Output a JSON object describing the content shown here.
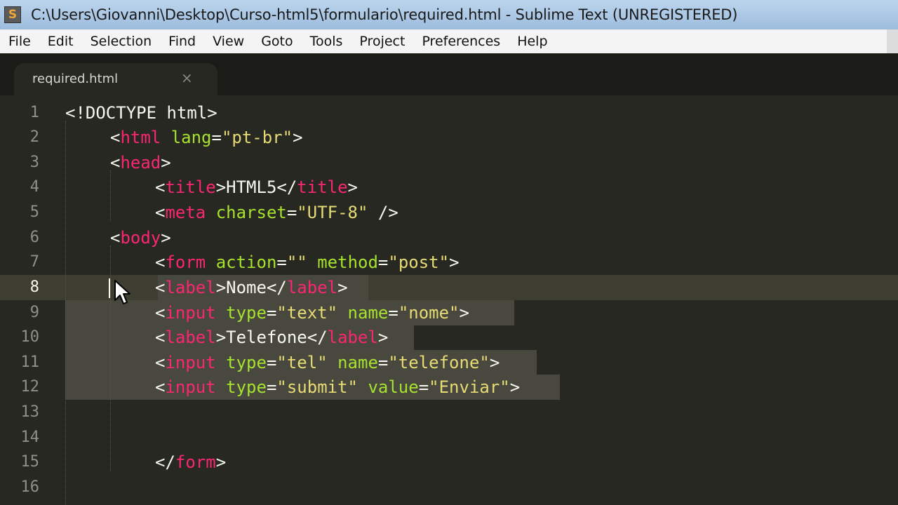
{
  "window": {
    "title": "C:\\Users\\Giovanni\\Desktop\\Curso-html5\\formulario\\required.html - Sublime Text (UNREGISTERED)",
    "icon_glyph": "S"
  },
  "menu": [
    "File",
    "Edit",
    "Selection",
    "Find",
    "View",
    "Goto",
    "Tools",
    "Project",
    "Preferences",
    "Help"
  ],
  "tab": {
    "label": "required.html",
    "close_glyph": "×"
  },
  "editor": {
    "active_line": 8,
    "line_numbers": [
      "1",
      "2",
      "3",
      "4",
      "5",
      "6",
      "7",
      "8",
      "9",
      "10",
      "11",
      "12",
      "13",
      "14",
      "15",
      "16"
    ],
    "lines": {
      "l1": {
        "t0": "<!DOCTYPE html>"
      },
      "l2": {
        "t0": "<",
        "t1": "html",
        "t2": " lang",
        "t3": "=",
        "t4": "\"pt-br\"",
        "t5": ">"
      },
      "l3": {
        "t0": "<",
        "t1": "head",
        "t2": ">"
      },
      "l4": {
        "t0": "<",
        "t1": "title",
        "t2": ">HTML5</",
        "t3": "title",
        "t4": ">"
      },
      "l5": {
        "t0": "<",
        "t1": "meta",
        "t2": " charset",
        "t3": "=",
        "t4": "\"UTF-8\"",
        "t5": " />"
      },
      "l6": {
        "t0": "<",
        "t1": "body",
        "t2": ">"
      },
      "l7": {
        "t0": "<",
        "t1": "form",
        "t2": " action",
        "t3": "=",
        "t4": "\"\"",
        "t5": " method",
        "t6": "=",
        "t7": "\"post\"",
        "t8": ">"
      },
      "l8": {
        "t0": "<",
        "t1": "label",
        "t2": ">Nome</",
        "t3": "label",
        "t4": ">"
      },
      "l9": {
        "t0": "<",
        "t1": "input",
        "t2": " type",
        "t3": "=",
        "t4": "\"text\"",
        "t5": " name",
        "t6": "=",
        "t7": "\"nome\"",
        "t8": ">"
      },
      "l10": {
        "t0": "<",
        "t1": "label",
        "t2": ">Telefone</",
        "t3": "label",
        "t4": ">"
      },
      "l11": {
        "t0": "<",
        "t1": "input",
        "t2": " type",
        "t3": "=",
        "t4": "\"tel\"",
        "t5": " name",
        "t6": "=",
        "t7": "\"telefone\"",
        "t8": ">"
      },
      "l12": {
        "t0": "<",
        "t1": "input",
        "t2": " type",
        "t3": "=",
        "t4": "\"submit\"",
        "t5": " value",
        "t6": "=",
        "t7": "\"Enviar\"",
        "t8": ">"
      },
      "l15": {
        "t0": "</",
        "t1": "form",
        "t2": ">"
      }
    }
  },
  "colors": {
    "background": "#272822",
    "tag": "#f92672",
    "attribute": "#a6e22e",
    "string": "#e6db74",
    "text": "#f8f8f2",
    "gutter": "#8f908a",
    "selection": "#49483e"
  },
  "icons": {
    "app": "sublime-text-icon",
    "pointer": "mouse-pointer-icon"
  }
}
